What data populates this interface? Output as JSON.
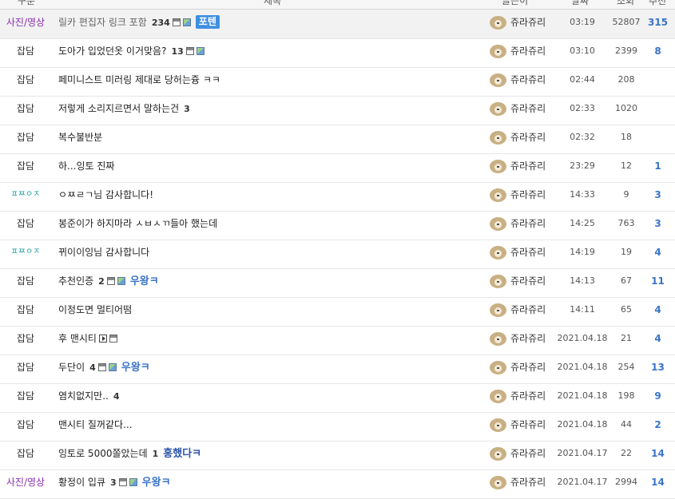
{
  "header": {
    "category": "구분",
    "title": "제목",
    "author": "글쓴이",
    "date": "날짜",
    "views": "조회",
    "votes": "추천"
  },
  "rows": [
    {
      "category": "사진/영상",
      "cat_style": "purple",
      "notice": true,
      "title": "릴카 편집자 링크 포함",
      "comments": "234",
      "icons": [
        "disk",
        "img"
      ],
      "badge": "포텐",
      "badge_style": "box",
      "author": "쥬라쥬리",
      "time": "03:19",
      "views": "52807",
      "votes": "315"
    },
    {
      "category": "잡담",
      "cat_style": "",
      "title": "도아가 입었던옷 이거맞음?",
      "comments": "13",
      "icons": [
        "disk",
        "img"
      ],
      "badge": "",
      "badge_style": "",
      "author": "쥬라쥬리",
      "time": "03:10",
      "views": "2399",
      "votes": "8"
    },
    {
      "category": "잡담",
      "cat_style": "",
      "title": "페미니스트 미러링 제대로 당허는즁 ㅋㅋ",
      "comments": "",
      "icons": [],
      "badge": "",
      "badge_style": "",
      "author": "쥬라쥬리",
      "time": "02:44",
      "views": "208",
      "votes": ""
    },
    {
      "category": "잡담",
      "cat_style": "",
      "title": "저렇게 소리지르면서 말하는건",
      "comments": "3",
      "icons": [],
      "badge": "",
      "badge_style": "",
      "author": "쥬라쥬리",
      "time": "02:33",
      "views": "1020",
      "votes": ""
    },
    {
      "category": "잡담",
      "cat_style": "",
      "title": "복수불반분",
      "comments": "",
      "icons": [],
      "badge": "",
      "badge_style": "",
      "author": "쥬라쥬리",
      "time": "02:32",
      "views": "18",
      "votes": ""
    },
    {
      "category": "잡담",
      "cat_style": "",
      "title": "하...잉토 진짜",
      "comments": "",
      "icons": [],
      "badge": "",
      "badge_style": "",
      "author": "쥬라쥬리",
      "time": "23:29",
      "views": "12",
      "votes": "1"
    },
    {
      "category": "ㅍㅉㅇㅈ",
      "cat_style": "teal",
      "title": "ㅇㅉㄹㄱ님 감사합니다!",
      "comments": "",
      "icons": [],
      "badge": "",
      "badge_style": "",
      "author": "쥬라쥬리",
      "time": "14:33",
      "views": "9",
      "votes": "3"
    },
    {
      "category": "잡담",
      "cat_style": "",
      "title": "봉준이가 하지마라 ㅅㅂㅅㄲ들아 했는데",
      "comments": "",
      "icons": [],
      "badge": "",
      "badge_style": "",
      "author": "쥬라쥬리",
      "time": "14:25",
      "views": "763",
      "votes": "3"
    },
    {
      "category": "ㅍㅉㅇㅈ",
      "cat_style": "teal",
      "title": "뀌이이잉님 감사합니다",
      "comments": "",
      "icons": [],
      "badge": "",
      "badge_style": "",
      "author": "쥬라쥬리",
      "time": "14:19",
      "views": "19",
      "votes": "4"
    },
    {
      "category": "잡담",
      "cat_style": "",
      "title": "추천인증",
      "comments": "2",
      "icons": [
        "disk",
        "img"
      ],
      "badge": "우왕ㅋ",
      "badge_style": "blue",
      "author": "쥬라쥬리",
      "time": "14:13",
      "views": "67",
      "votes": "11"
    },
    {
      "category": "잡담",
      "cat_style": "",
      "title": "이정도면 멀티어떰",
      "comments": "",
      "icons": [],
      "badge": "",
      "badge_style": "",
      "author": "쥬라쥬리",
      "time": "14:11",
      "views": "65",
      "votes": "4"
    },
    {
      "category": "잡담",
      "cat_style": "",
      "title": "후 맨시티",
      "comments": "",
      "icons": [
        "vid",
        "disk"
      ],
      "badge": "",
      "badge_style": "",
      "author": "쥬라쥬리",
      "time": "2021.04.18",
      "views": "21",
      "votes": "4"
    },
    {
      "category": "잡담",
      "cat_style": "",
      "title": "두단이",
      "comments": "4",
      "icons": [
        "disk",
        "img"
      ],
      "badge": "우왕ㅋ",
      "badge_style": "blue",
      "author": "쥬라쥬리",
      "time": "2021.04.18",
      "views": "254",
      "votes": "13"
    },
    {
      "category": "잡담",
      "cat_style": "",
      "title": "염치없지만..",
      "comments": "4",
      "icons": [],
      "badge": "",
      "badge_style": "",
      "author": "쥬라쥬리",
      "time": "2021.04.18",
      "views": "198",
      "votes": "9"
    },
    {
      "category": "잡담",
      "cat_style": "",
      "title": "맨시티 질꺼같다...",
      "comments": "",
      "icons": [],
      "badge": "",
      "badge_style": "",
      "author": "쥬라쥬리",
      "time": "2021.04.18",
      "views": "44",
      "votes": "2"
    },
    {
      "category": "잡담",
      "cat_style": "",
      "title": "잉토로 5000쫄았는데",
      "comments": "1",
      "icons": [],
      "badge": "홍했다ㅋ",
      "badge_style": "navy",
      "author": "쥬라쥬리",
      "time": "2021.04.17",
      "views": "22",
      "votes": "14"
    },
    {
      "category": "사진/영상",
      "cat_style": "purple",
      "title": "황정이 입큐",
      "comments": "3",
      "icons": [
        "disk",
        "img"
      ],
      "badge": "우왕ㅋ",
      "badge_style": "blue",
      "author": "쥬라쥬리",
      "time": "2021.04.17",
      "views": "2994",
      "votes": "14"
    }
  ]
}
